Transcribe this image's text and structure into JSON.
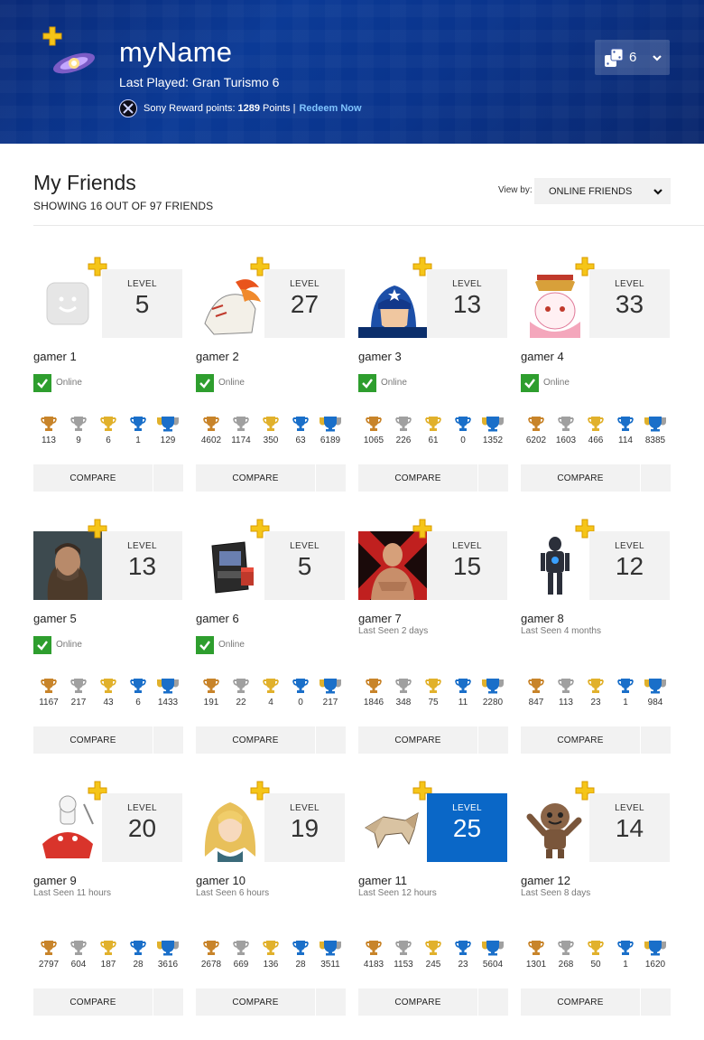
{
  "header": {
    "name": "myName",
    "last_played": "Last Played: Gran Turismo 6",
    "reward_label": "Sony Reward points:",
    "reward_points": "1289",
    "reward_suffix": "Points |",
    "redeem": "Redeem Now",
    "friends_count": "6"
  },
  "section": {
    "title": "My Friends",
    "subtitle": "SHOWING 16 OUT OF 97 FRIENDS",
    "viewby_label": "View by:",
    "viewby_value": "ONLINE FRIENDS"
  },
  "compare_label": "COMPARE",
  "level_label": "LEVEL",
  "colors": {
    "bronze": "#c8842a",
    "silver": "#a0a0a0",
    "gold": "#e1b12c",
    "platinum": "#1a6fc9",
    "online": "#2e9e2e",
    "highlight": "#0a67c7"
  },
  "friends": [
    {
      "name": "gamer 1",
      "level": "5",
      "status": "Online",
      "online": true,
      "avatar": "smiley-avatar",
      "trophies": [
        "113",
        "9",
        "6",
        "1",
        "129"
      ]
    },
    {
      "name": "gamer 2",
      "level": "27",
      "status": "Online",
      "online": true,
      "avatar": "wolf-avatar",
      "trophies": [
        "4602",
        "1174",
        "350",
        "63",
        "6189"
      ]
    },
    {
      "name": "gamer 3",
      "level": "13",
      "status": "Online",
      "online": true,
      "avatar": "captain-avatar",
      "trophies": [
        "1065",
        "226",
        "61",
        "0",
        "1352"
      ]
    },
    {
      "name": "gamer 4",
      "level": "33",
      "status": "Online",
      "online": true,
      "avatar": "bunny-avatar",
      "trophies": [
        "6202",
        "1603",
        "466",
        "114",
        "8385"
      ]
    },
    {
      "name": "gamer 5",
      "level": "13",
      "status": "Online",
      "online": true,
      "avatar": "man-avatar",
      "trophies": [
        "1167",
        "217",
        "43",
        "6",
        "1433"
      ]
    },
    {
      "name": "gamer 6",
      "level": "5",
      "status": "Online",
      "online": true,
      "avatar": "arcade-avatar",
      "trophies": [
        "191",
        "22",
        "4",
        "0",
        "217"
      ]
    },
    {
      "name": "gamer 7",
      "level": "15",
      "status": "Last Seen 2 days",
      "online": false,
      "avatar": "wrestler-avatar",
      "trophies": [
        "1846",
        "348",
        "75",
        "11",
        "2280"
      ]
    },
    {
      "name": "gamer 8",
      "level": "12",
      "status": "Last Seen 4 months",
      "online": false,
      "avatar": "robot-avatar",
      "trophies": [
        "847",
        "113",
        "23",
        "1",
        "984"
      ]
    },
    {
      "name": "gamer 9",
      "level": "20",
      "status": "Last Seen 11 hours",
      "online": false,
      "avatar": "chef-avatar",
      "trophies": [
        "2797",
        "604",
        "187",
        "28",
        "3616"
      ]
    },
    {
      "name": "gamer 10",
      "level": "19",
      "status": "Last Seen 6 hours",
      "online": false,
      "avatar": "blonde-avatar",
      "trophies": [
        "2678",
        "669",
        "136",
        "28",
        "3511"
      ]
    },
    {
      "name": "gamer 11",
      "level": "25",
      "status": "Last Seen 12 hours",
      "online": false,
      "avatar": "origami-avatar",
      "highlight": true,
      "trophies": [
        "4183",
        "1153",
        "245",
        "23",
        "5604"
      ]
    },
    {
      "name": "gamer 12",
      "level": "14",
      "status": "Last Seen 8 days",
      "online": false,
      "avatar": "sackboy-avatar",
      "trophies": [
        "1301",
        "268",
        "50",
        "1",
        "1620"
      ]
    }
  ]
}
